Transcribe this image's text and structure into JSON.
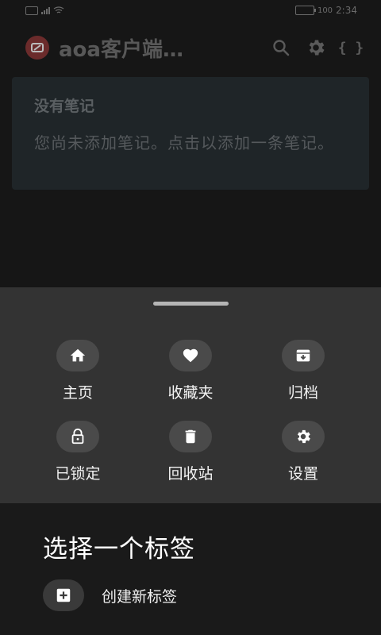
{
  "status_bar": {
    "left_glyphs": [
      "sim-icon",
      "signal-icon",
      "wifi-icon"
    ],
    "battery": "100",
    "time": "2:34"
  },
  "app_bar": {
    "title": "aoa客户端…",
    "actions": [
      "search-icon",
      "settings-icon",
      "braces-icon"
    ],
    "braces_text": "{ }"
  },
  "empty_state": {
    "title": "没有笔记",
    "description": "您尚未添加笔记。点击以添加一条笔记。"
  },
  "bottom_sheet": {
    "items": [
      {
        "label": "主页",
        "icon": "home-icon"
      },
      {
        "label": "收藏夹",
        "icon": "heart-icon"
      },
      {
        "label": "归档",
        "icon": "archive-icon"
      },
      {
        "label": "已锁定",
        "icon": "lock-icon"
      },
      {
        "label": "回收站",
        "icon": "trash-icon"
      },
      {
        "label": "设置",
        "icon": "gear-icon"
      }
    ]
  },
  "tags": {
    "title": "选择一个标签",
    "new_tag_label": "创建新标签"
  },
  "colors": {
    "background": "#161616",
    "sheet": "#333333",
    "card": "#1f2528",
    "logo": "#6b2b2b"
  }
}
